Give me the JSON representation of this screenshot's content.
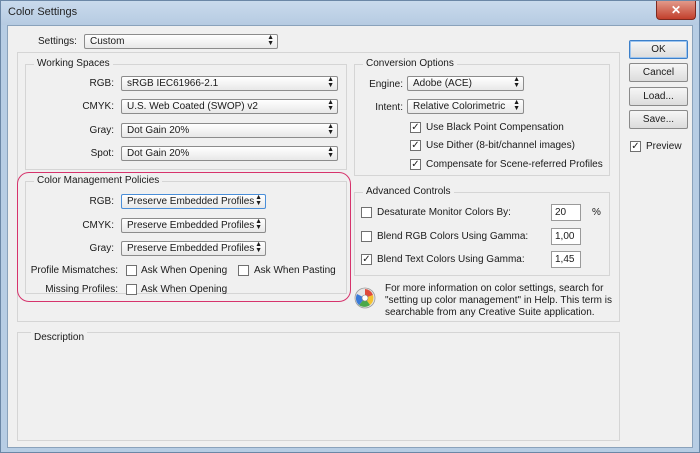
{
  "window": {
    "title": "Color Settings",
    "close_glyph": "✕"
  },
  "settings": {
    "label": "Settings:",
    "value": "Custom"
  },
  "working_spaces": {
    "title": "Working Spaces",
    "rgb": {
      "label": "RGB:",
      "value": "sRGB IEC61966-2.1"
    },
    "cmyk": {
      "label": "CMYK:",
      "value": "U.S. Web Coated (SWOP) v2"
    },
    "gray": {
      "label": "Gray:",
      "value": "Dot Gain 20%"
    },
    "spot": {
      "label": "Spot:",
      "value": "Dot Gain 20%"
    }
  },
  "conversion_options": {
    "title": "Conversion Options",
    "engine": {
      "label": "Engine:",
      "value": "Adobe (ACE)"
    },
    "intent": {
      "label": "Intent:",
      "value": "Relative Colorimetric"
    },
    "black_point": {
      "label": "Use Black Point Compensation",
      "checked": true
    },
    "dither": {
      "label": "Use Dither (8-bit/channel images)",
      "checked": true
    },
    "compensate": {
      "label": "Compensate for Scene-referred Profiles",
      "checked": true
    }
  },
  "policies": {
    "title": "Color Management Policies",
    "rgb": {
      "label": "RGB:",
      "value": "Preserve Embedded Profiles"
    },
    "cmyk": {
      "label": "CMYK:",
      "value": "Preserve Embedded Profiles"
    },
    "gray": {
      "label": "Gray:",
      "value": "Preserve Embedded Profiles"
    },
    "mismatches": {
      "label": "Profile Mismatches:",
      "ask_opening": "Ask When Opening",
      "ask_pasting": "Ask When Pasting"
    },
    "missing": {
      "label": "Missing Profiles:",
      "ask_opening": "Ask When Opening"
    }
  },
  "advanced": {
    "title": "Advanced Controls",
    "desaturate": {
      "label": "Desaturate Monitor Colors By:",
      "value": "20",
      "unit": "%",
      "checked": false
    },
    "blend_rgb": {
      "label": "Blend RGB Colors Using Gamma:",
      "value": "1,00",
      "checked": false
    },
    "blend_text": {
      "label": "Blend Text Colors Using Gamma:",
      "value": "1,45",
      "checked": true
    }
  },
  "info": {
    "text": "For more information on color settings, search for \"setting up color management\" in Help. This term is searchable from any Creative Suite application."
  },
  "description": {
    "title": "Description"
  },
  "buttons": {
    "ok": "OK",
    "cancel": "Cancel",
    "load": "Load...",
    "save": "Save...",
    "preview": "Preview"
  },
  "colors": {
    "highlight": "#d6336c",
    "accent_border": "#3c7fc9"
  }
}
